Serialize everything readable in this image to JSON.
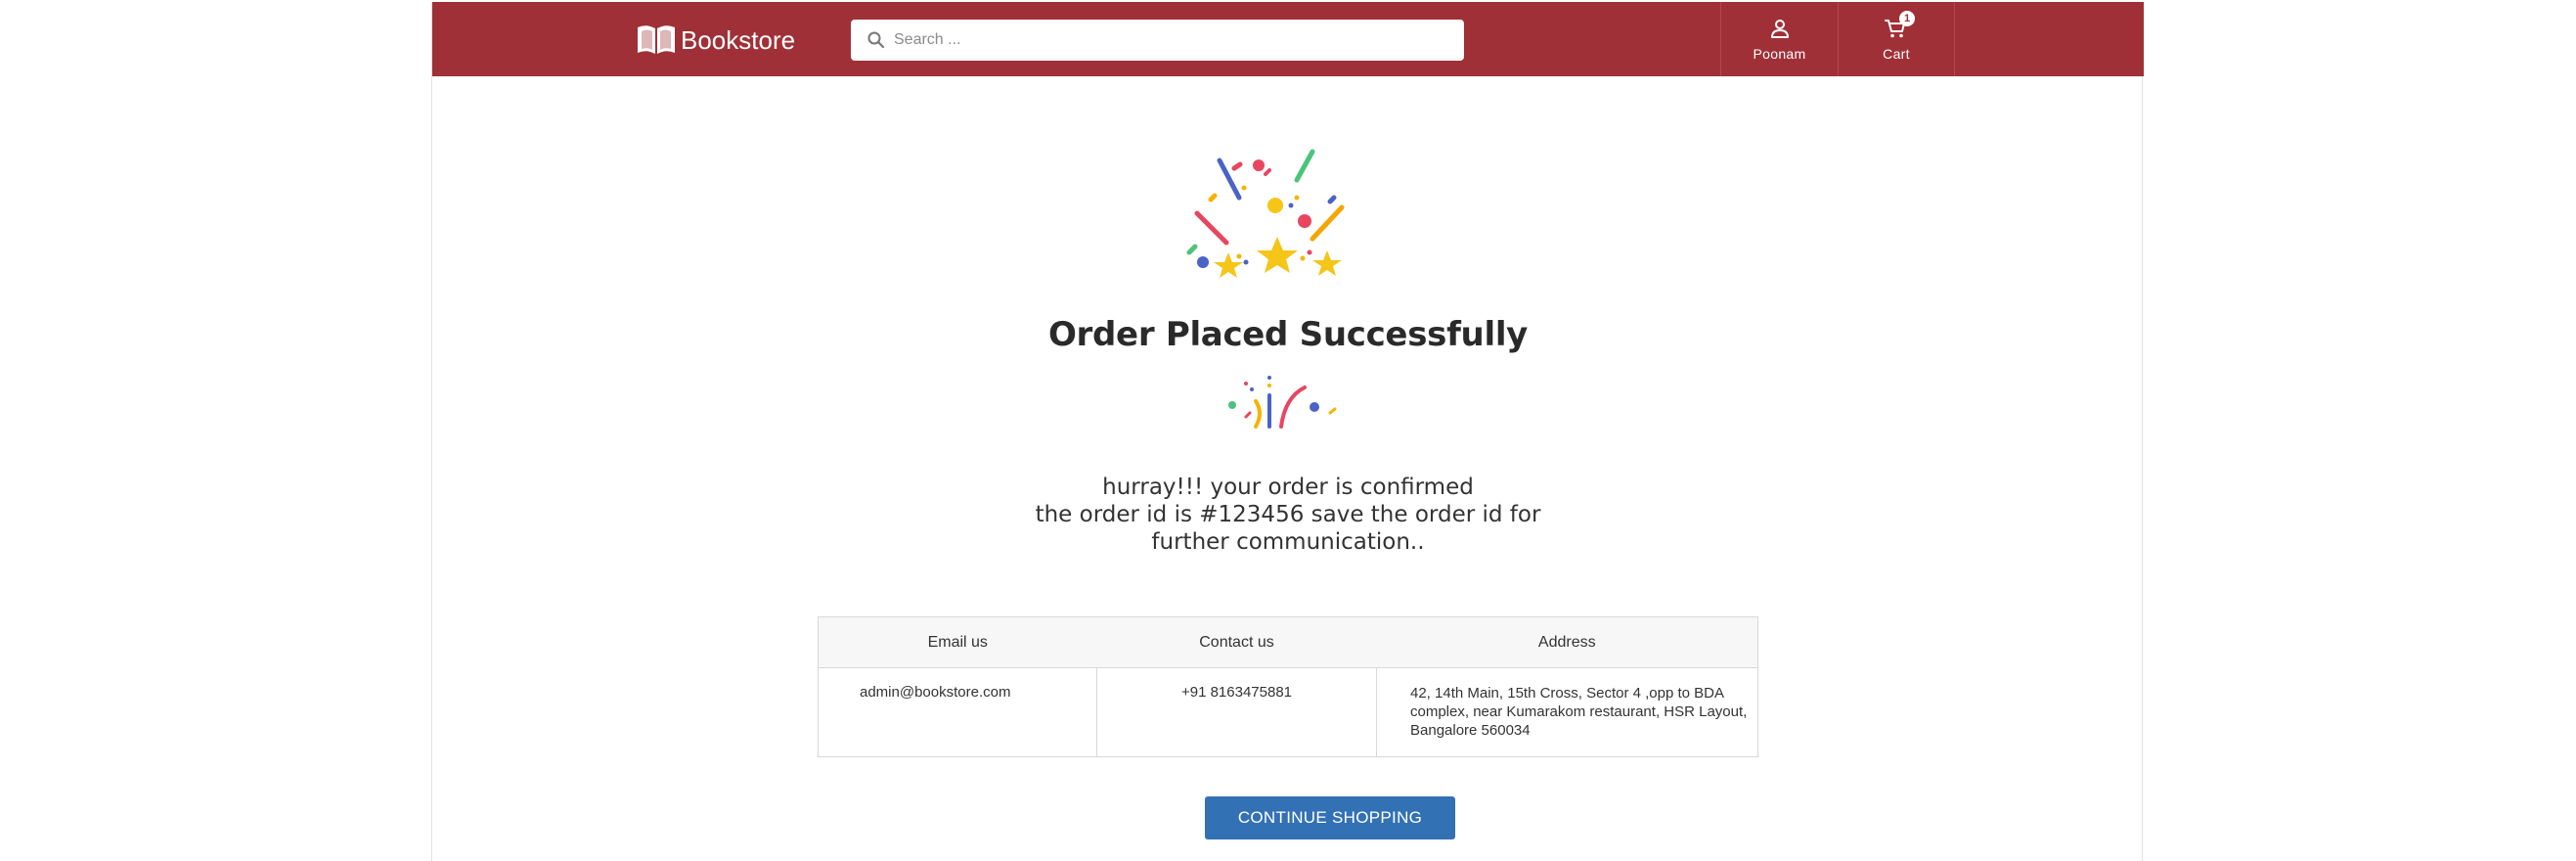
{
  "header": {
    "logo_text": "Bookstore",
    "logo_icon": "open-book-icon",
    "search_placeholder": "Search ...",
    "profile_label": "Poonam",
    "cart_label": "Cart",
    "cart_count": "1"
  },
  "main": {
    "title": "Order Placed Successfully",
    "message_line1": "hurray!!! your order is confirmed",
    "message_line2": "the order id is #123456 save the order id for",
    "message_line3": "further communication.."
  },
  "contact_table": {
    "headers": [
      "Email us",
      "Contact us",
      "Address"
    ],
    "email": "admin@bookstore.com",
    "phone": "+91 8163475881",
    "address_line1": "42, 14th Main, 15th Cross, Sector 4 ,opp to BDA",
    "address_line2": "complex, near Kumarakom restaurant, HSR Layout,",
    "address_line3": "Bangalore 560034"
  },
  "actions": {
    "continue_label": "CONTINUE SHOPPING"
  },
  "colors": {
    "header_bg": "#a03037",
    "button_bg": "#3371b5"
  }
}
